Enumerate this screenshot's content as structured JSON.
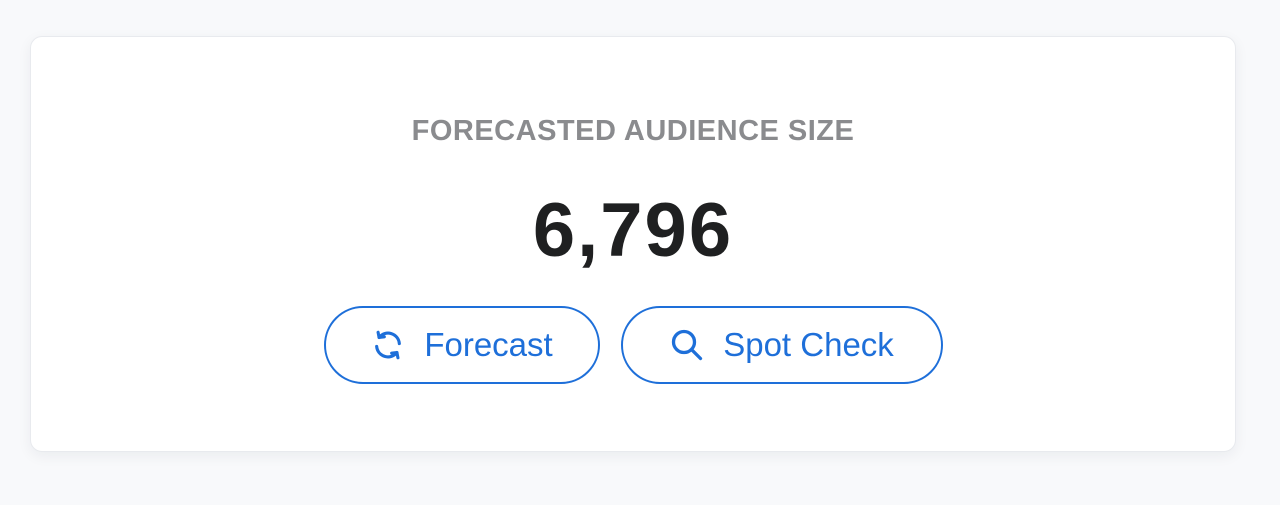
{
  "card": {
    "label": "FORECASTED AUDIENCE SIZE",
    "value": "6,796"
  },
  "actions": {
    "forecast": {
      "label": "Forecast",
      "icon": "refresh-icon"
    },
    "spot_check": {
      "label": "Spot Check",
      "icon": "search-icon"
    }
  },
  "colors": {
    "accent": "#1e6fd9",
    "label": "#8a8b8e",
    "value": "#1f2021",
    "background": "#f8f9fb",
    "card": "#ffffff"
  }
}
